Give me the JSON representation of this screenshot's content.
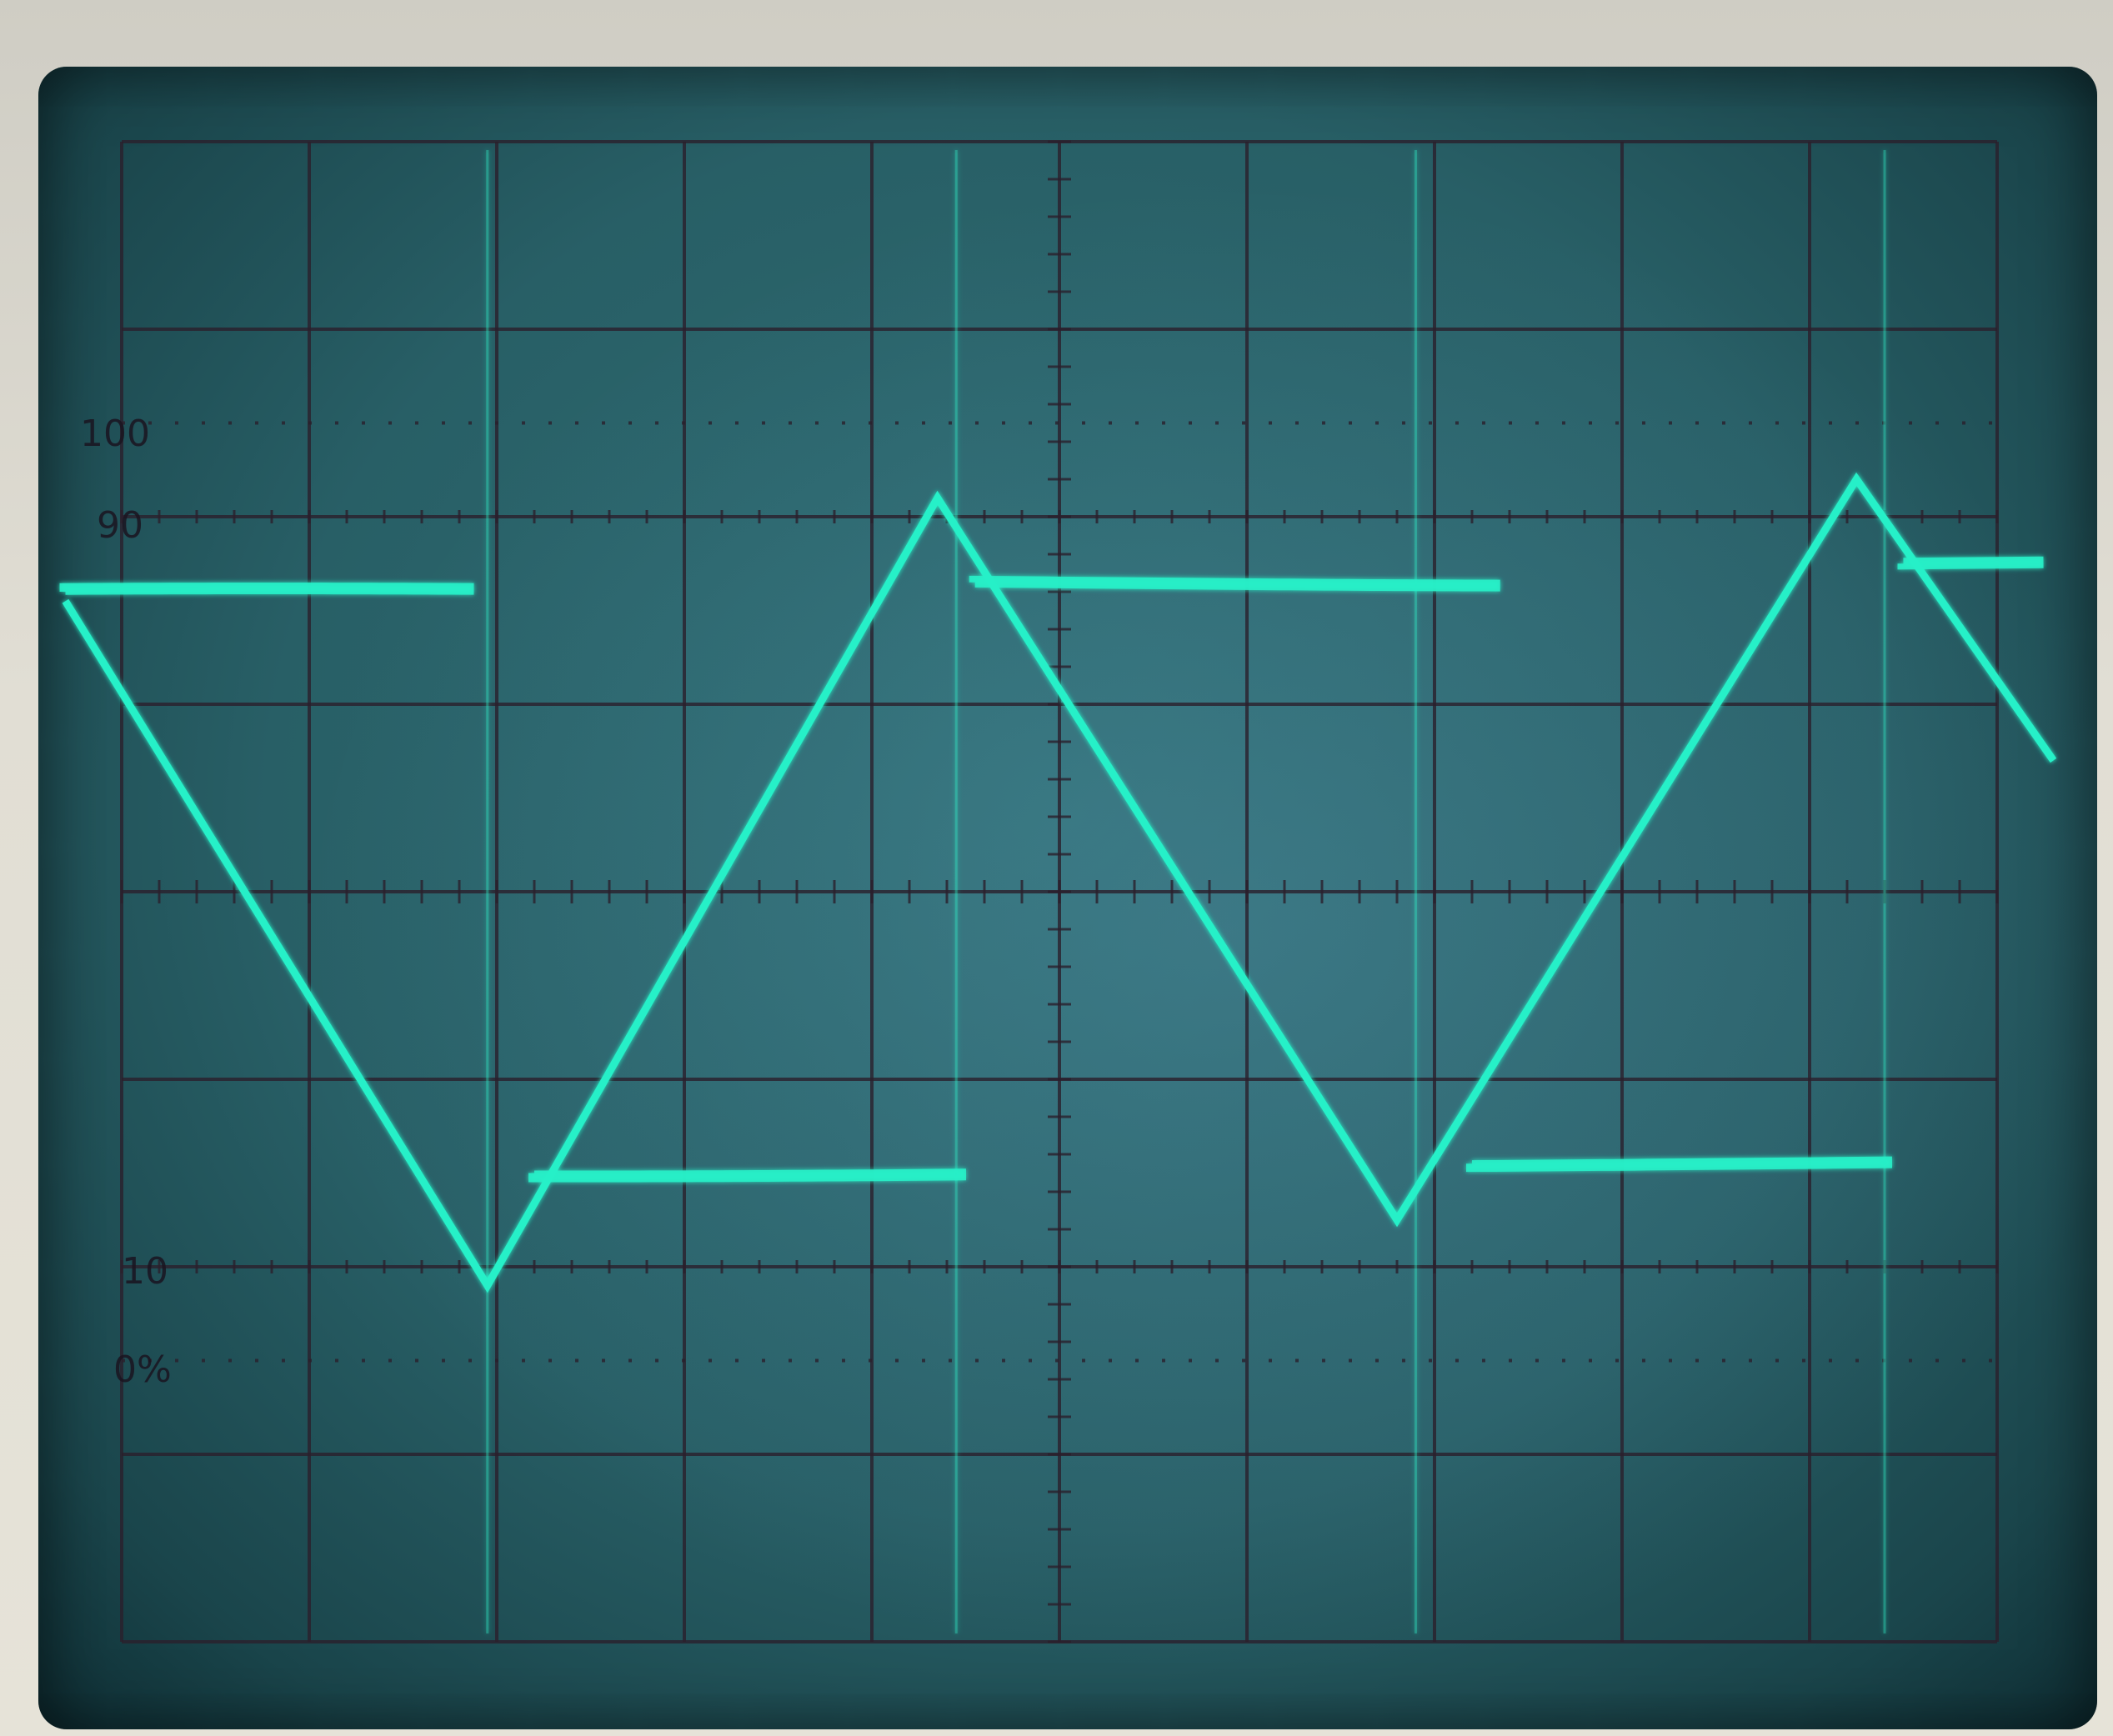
{
  "graticule": {
    "labels": [
      "100",
      "90",
      "10",
      "0%"
    ],
    "divisions_x": 10,
    "divisions_y": 8
  },
  "trace_color": "#27f0c8",
  "grid_color": "#2a1f2c",
  "chart_data": {
    "type": "line",
    "title": "",
    "xlabel": "",
    "ylabel": "",
    "xlim": [
      0,
      10
    ],
    "ylim": [
      -4,
      4
    ],
    "series": [
      {
        "shape": "triangle",
        "x": [
          -0.3,
          1.95,
          4.35,
          6.8,
          9.25,
          10.3
        ],
        "y": [
          1.55,
          -2.1,
          2.1,
          -1.75,
          2.2,
          0.7
        ]
      },
      {
        "shape": "square",
        "segments": [
          {
            "x": [
              -0.3,
              1.9
            ],
            "y": 1.6
          },
          {
            "x": [
              2.2,
              4.55
            ],
            "y": -1.5
          },
          {
            "x": [
              4.55,
              7.4
            ],
            "y": 1.65
          },
          {
            "x": [
              7.2,
              9.5
            ],
            "y": -1.45
          },
          {
            "x": [
              9.5,
              10.3
            ],
            "y": 1.75
          }
        ],
        "edges_x": [
          1.95,
          4.45,
          6.9,
          9.4
        ]
      }
    ]
  }
}
